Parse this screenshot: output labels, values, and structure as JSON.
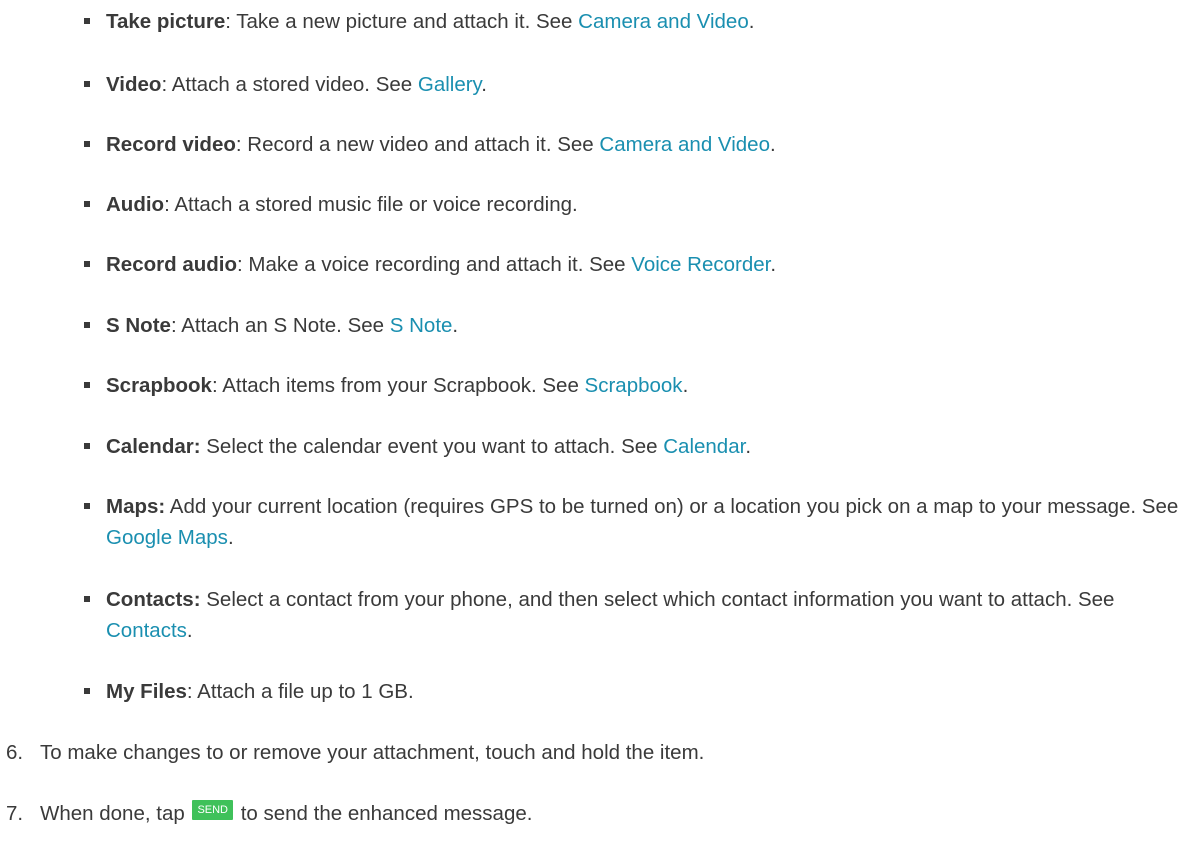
{
  "bullets": [
    {
      "term": "Take picture",
      "sep": ":",
      "text": " Take a new picture and attach it. See ",
      "link": "Camera and Video",
      "end": "."
    },
    {
      "term": "Video",
      "sep": ":",
      "text": " Attach a stored video. See ",
      "link": "Gallery",
      "end": "."
    },
    {
      "term": "Record video",
      "sep": ":",
      "text": " Record a new video and attach it. See ",
      "link": "Camera and Video",
      "end": "."
    },
    {
      "term": "Audio",
      "sep": ":",
      "text": " Attach a stored music file or voice recording.",
      "link": "",
      "end": ""
    },
    {
      "term": "Record audio",
      "sep": ":",
      "text": " Make a voice recording and attach it. See ",
      "link": "Voice Recorder",
      "end": "."
    },
    {
      "term": "S Note",
      "sep": ":",
      "text": " Attach an S Note. See ",
      "link": "S Note",
      "end": "."
    },
    {
      "term": "Scrapbook",
      "sep": ":",
      "text": " Attach items from your Scrapbook. See ",
      "link": "Scrapbook",
      "end": "."
    },
    {
      "term": "Calendar:",
      "sep": "",
      "text": " Select the calendar event you want to attach. See ",
      "link": "Calendar",
      "end": "."
    },
    {
      "term": "Maps:",
      "sep": "",
      "text": " Add your current location (requires GPS to be turned on) or a location you pick on a map to your message. See ",
      "link": "Google Maps",
      "end": "."
    },
    {
      "term": "Contacts:",
      "sep": "",
      "text": " Select a contact from your phone, and then select which contact information you want to attach. See ",
      "link": "Contacts",
      "end": "."
    },
    {
      "term": "My Files",
      "sep": ":",
      "text": " Attach a file up to 1 GB.",
      "link": "",
      "end": ""
    }
  ],
  "steps": [
    {
      "num": "6.",
      "text": "To make changes to or remove your attachment, touch and hold the item."
    },
    {
      "num": "7.",
      "before": "When done, tap ",
      "button": "SEND",
      "after": " to send the enhanced message."
    }
  ],
  "colors": {
    "link": "#1a8fb0",
    "send_button": "#3fc15a",
    "text": "#3a3a3a"
  }
}
